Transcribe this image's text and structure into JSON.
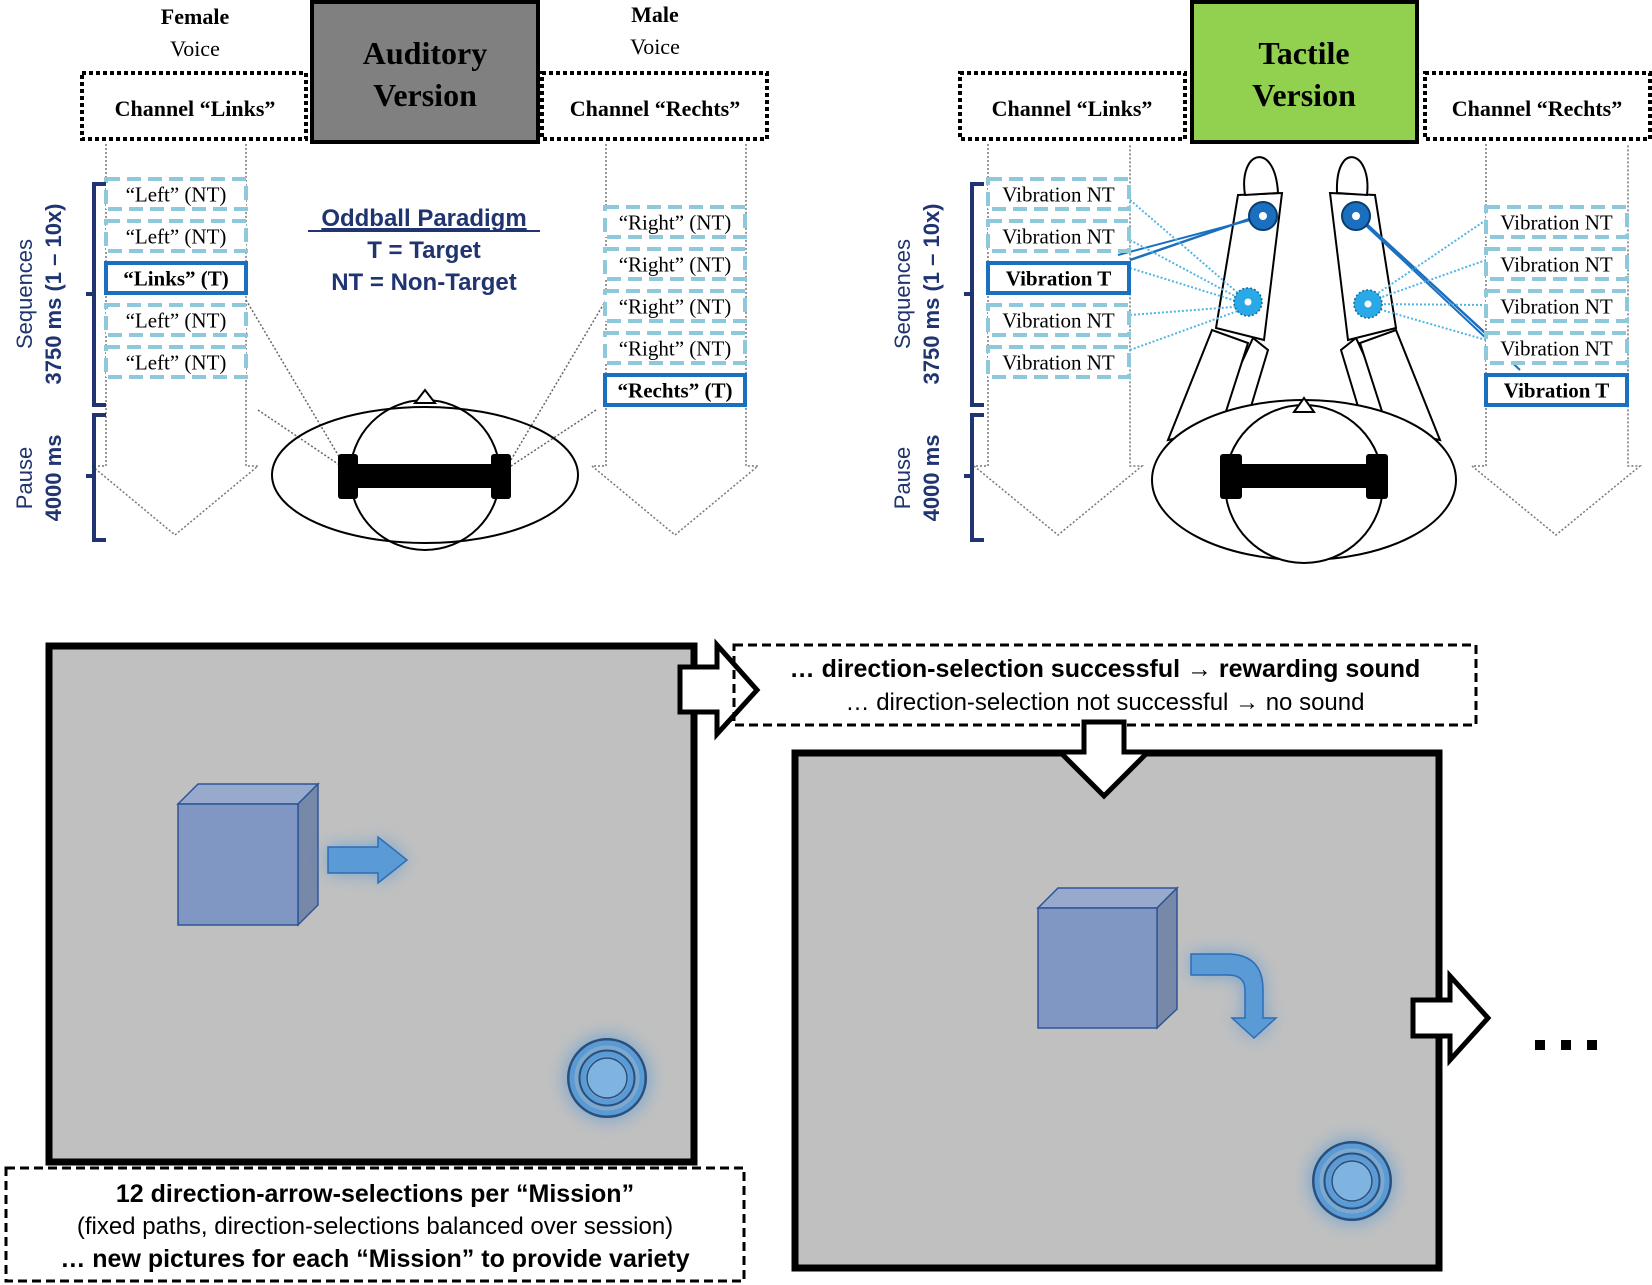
{
  "colors": {
    "navy": "#1f3470",
    "nt_dash": "#8ec9db",
    "target_border": "#1a6fbf",
    "auditory_box": "#808080",
    "tactile_box": "#92d050",
    "screen_bg": "#c0c0c0",
    "cube_front": "#7f97c2",
    "cube_top": "#97a9cc",
    "cube_side": "#7788a8",
    "arrow_blue": "#5b9bd5",
    "tactor_dark": "#1a6fbf",
    "tactor_light": "#29a9e8"
  },
  "auditory": {
    "title_line1": "Auditory",
    "title_line2": "Version",
    "left_voice_line1": "Female",
    "left_voice_line2": "Voice",
    "right_voice_line1": "Male",
    "right_voice_line2": "Voice",
    "left_channel": "Channel “Links”",
    "right_channel": "Channel “Rechts”",
    "left_stimuli": [
      {
        "label": "“Left” (NT)",
        "target": false
      },
      {
        "label": "“Left” (NT)",
        "target": false
      },
      {
        "label": "“Links” (T)",
        "target": true
      },
      {
        "label": "“Left” (NT)",
        "target": false
      },
      {
        "label": "“Left” (NT)",
        "target": false
      }
    ],
    "right_stimuli": [
      {
        "label": "“Right” (NT)",
        "target": false
      },
      {
        "label": "“Right” (NT)",
        "target": false
      },
      {
        "label": "“Right” (NT)",
        "target": false
      },
      {
        "label": "“Right” (NT)",
        "target": false
      },
      {
        "label": "“Rechts” (T)",
        "target": true
      }
    ],
    "legend": {
      "title": "Oddball Paradigm",
      "line1": "T = Target",
      "line2": "NT = Non-Target"
    },
    "timing": {
      "sequences_label": "Sequences",
      "sequences_value": "3750 ms (1 – 10x)",
      "pause_label": "Pause",
      "pause_value": "4000 ms"
    }
  },
  "tactile": {
    "title_line1": "Tactile",
    "title_line2": "Version",
    "left_channel": "Channel “Links”",
    "right_channel": "Channel “Rechts”",
    "left_stimuli": [
      {
        "label": "Vibration NT",
        "target": false
      },
      {
        "label": "Vibration NT",
        "target": false
      },
      {
        "label": "Vibration T",
        "target": true
      },
      {
        "label": "Vibration NT",
        "target": false
      },
      {
        "label": "Vibration NT",
        "target": false
      }
    ],
    "right_stimuli": [
      {
        "label": "Vibration NT",
        "target": false
      },
      {
        "label": "Vibration NT",
        "target": false
      },
      {
        "label": "Vibration NT",
        "target": false
      },
      {
        "label": "Vibration NT",
        "target": false
      },
      {
        "label": "Vibration T",
        "target": true
      }
    ],
    "timing": {
      "sequences_label": "Sequences",
      "sequences_value": "3750 ms (1 – 10x)",
      "pause_label": "Pause",
      "pause_value": "4000 ms"
    }
  },
  "task": {
    "feedback_line1": "… direction-selection successful → rewarding sound",
    "feedback_line2": "… direction-selection not successful → no sound",
    "mission_line1": "12 direction-arrow-selections per “Mission”",
    "mission_line2": "(fixed paths, direction-selections balanced over session)",
    "mission_line3": "… new pictures for each “Mission” to provide variety",
    "continuation": "…",
    "screen1_arrow": "arrow-right",
    "screen2_arrow": "arrow-turn-down"
  }
}
